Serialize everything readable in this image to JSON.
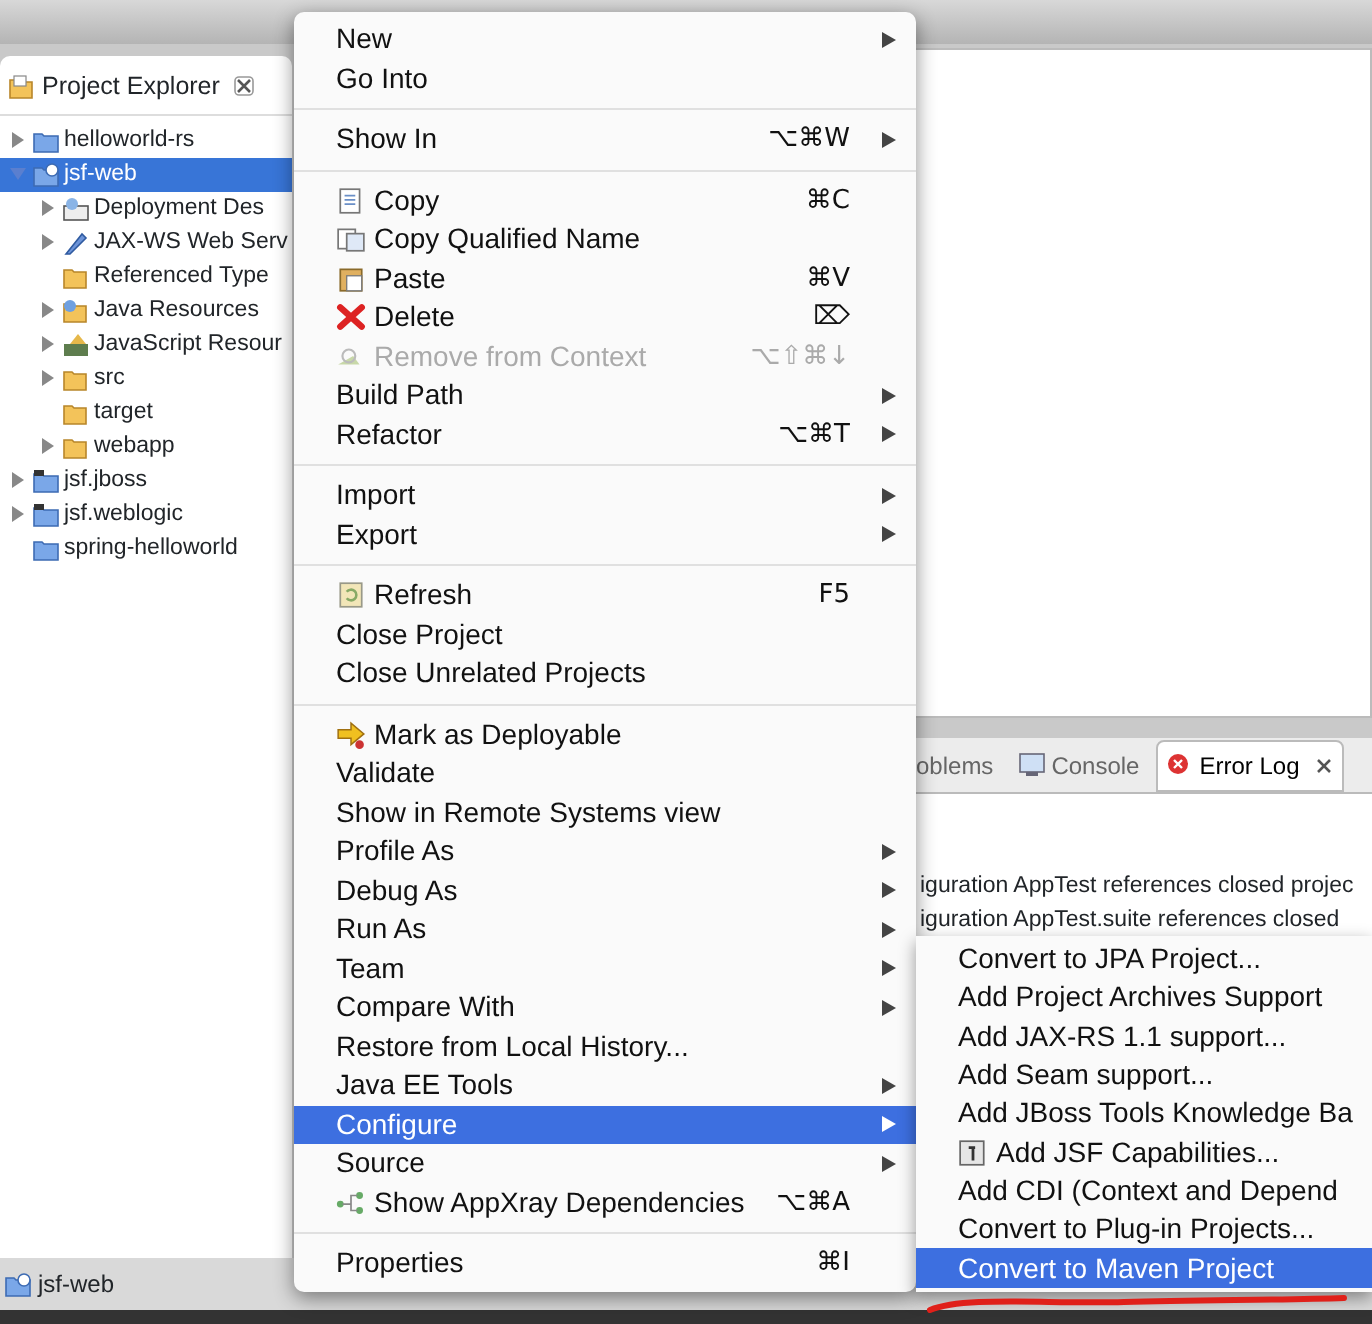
{
  "explorer": {
    "title": "Project Explorer",
    "tree": [
      {
        "label": "helloworld-rs",
        "kind": "project",
        "expanded": false,
        "selected": false
      },
      {
        "label": "jsf-web",
        "kind": "web-project",
        "expanded": true,
        "selected": true,
        "children": [
          {
            "label": "Deployment Des",
            "kind": "descriptor",
            "expanded": false,
            "selected": false
          },
          {
            "label": "JAX-WS Web Serv",
            "kind": "webservice",
            "expanded": false,
            "selected": false
          },
          {
            "label": "Referenced Type",
            "kind": "folder",
            "selected": false
          },
          {
            "label": "Java Resources",
            "kind": "java-resources",
            "expanded": false,
            "selected": false
          },
          {
            "label": "JavaScript Resour",
            "kind": "js-resources",
            "expanded": false,
            "selected": false
          },
          {
            "label": "src",
            "kind": "folder",
            "expanded": false,
            "selected": false
          },
          {
            "label": "target",
            "kind": "folder",
            "selected": false
          },
          {
            "label": "webapp",
            "kind": "folder",
            "expanded": false,
            "selected": false
          }
        ]
      },
      {
        "label": "jsf.jboss",
        "kind": "maven-project",
        "expanded": false,
        "selected": false
      },
      {
        "label": "jsf.weblogic",
        "kind": "maven-project",
        "expanded": false,
        "selected": false
      },
      {
        "label": "spring-helloworld",
        "kind": "project",
        "selected": false
      }
    ]
  },
  "bottom_panel": {
    "tabs": [
      {
        "label": "oblems",
        "kind": "plain",
        "selected": false
      },
      {
        "label": "Console",
        "kind": "console",
        "selected": false
      },
      {
        "label": "Error Log",
        "kind": "error-log",
        "selected": true
      }
    ],
    "log_lines": [
      "iguration AppTest references closed projec",
      "iguration AppTest.suite references closed"
    ]
  },
  "status_bar": {
    "label": "jsf-web"
  },
  "context_menu": {
    "groups": [
      [
        {
          "label": "New",
          "kind": "plain",
          "submenu": true,
          "disabled": false,
          "selected": false
        },
        {
          "label": "Go Into",
          "kind": "plain",
          "submenu": false,
          "disabled": false,
          "selected": false
        }
      ],
      [
        {
          "label": "Show In",
          "kind": "plain",
          "shortcut": "⌥⌘W",
          "submenu": true,
          "disabled": false,
          "selected": false
        }
      ],
      [
        {
          "label": "Copy",
          "kind": "copy",
          "shortcut": "⌘C",
          "submenu": false,
          "disabled": false,
          "selected": false
        },
        {
          "label": "Copy Qualified Name",
          "kind": "copy-name",
          "submenu": false,
          "disabled": false,
          "selected": false
        },
        {
          "label": "Paste",
          "kind": "paste",
          "shortcut": "⌘V",
          "submenu": false,
          "disabled": false,
          "selected": false
        },
        {
          "label": "Delete",
          "kind": "delete",
          "shortcut": "⌦",
          "submenu": false,
          "disabled": false,
          "selected": false
        },
        {
          "label": "Remove from Context",
          "kind": "remove",
          "shortcut": "⌥⇧⌘↓",
          "submenu": false,
          "disabled": true,
          "selected": false
        },
        {
          "label": "Build Path",
          "kind": "plain",
          "submenu": true,
          "disabled": false,
          "selected": false
        },
        {
          "label": "Refactor",
          "kind": "plain",
          "shortcut": "⌥⌘T",
          "submenu": true,
          "disabled": false,
          "selected": false
        }
      ],
      [
        {
          "label": "Import",
          "kind": "plain",
          "submenu": true,
          "disabled": false,
          "selected": false
        },
        {
          "label": "Export",
          "kind": "plain",
          "submenu": true,
          "disabled": false,
          "selected": false
        }
      ],
      [
        {
          "label": "Refresh",
          "kind": "refresh",
          "shortcut": "F5",
          "submenu": false,
          "disabled": false,
          "selected": false
        },
        {
          "label": "Close Project",
          "kind": "plain",
          "submenu": false,
          "disabled": false,
          "selected": false
        },
        {
          "label": "Close Unrelated Projects",
          "kind": "plain",
          "submenu": false,
          "disabled": false,
          "selected": false
        }
      ],
      [
        {
          "label": "Mark as Deployable",
          "kind": "deploy",
          "submenu": false,
          "disabled": false,
          "selected": false
        },
        {
          "label": "Validate",
          "kind": "plain",
          "submenu": false,
          "disabled": false,
          "selected": false
        },
        {
          "label": "Show in Remote Systems view",
          "kind": "plain",
          "submenu": false,
          "disabled": false,
          "selected": false
        },
        {
          "label": "Profile As",
          "kind": "plain",
          "submenu": true,
          "disabled": false,
          "selected": false
        },
        {
          "label": "Debug As",
          "kind": "plain",
          "submenu": true,
          "disabled": false,
          "selected": false
        },
        {
          "label": "Run As",
          "kind": "plain",
          "submenu": true,
          "disabled": false,
          "selected": false
        },
        {
          "label": "Team",
          "kind": "plain",
          "submenu": true,
          "disabled": false,
          "selected": false
        },
        {
          "label": "Compare With",
          "kind": "plain",
          "submenu": true,
          "disabled": false,
          "selected": false
        },
        {
          "label": "Restore from Local History...",
          "kind": "plain",
          "submenu": false,
          "disabled": false,
          "selected": false
        },
        {
          "label": "Java EE Tools",
          "kind": "plain",
          "submenu": true,
          "disabled": false,
          "selected": false
        },
        {
          "label": "Configure",
          "kind": "plain",
          "submenu": true,
          "disabled": false,
          "selected": true
        },
        {
          "label": "Source",
          "kind": "plain",
          "submenu": true,
          "disabled": false,
          "selected": false
        },
        {
          "label": "Show AppXray Dependencies",
          "kind": "graph",
          "shortcut": "⌥⌘A",
          "submenu": false,
          "disabled": false,
          "selected": false
        }
      ],
      [
        {
          "label": "Properties",
          "kind": "plain",
          "shortcut": "⌘I",
          "submenu": false,
          "disabled": false,
          "selected": false
        }
      ]
    ]
  },
  "configure_submenu": {
    "items": [
      {
        "label": "Convert to JPA Project...",
        "kind": "plain",
        "selected": false
      },
      {
        "label": "Add Project Archives Support",
        "kind": "plain",
        "selected": false
      },
      {
        "label": "Add JAX-RS 1.1 support...",
        "kind": "plain",
        "selected": false
      },
      {
        "label": "Add Seam support...",
        "kind": "plain",
        "selected": false
      },
      {
        "label": "Add JBoss Tools Knowledge Ba",
        "kind": "plain",
        "selected": false
      },
      {
        "label": "Add JSF Capabilities...",
        "kind": "jsf",
        "selected": false
      },
      {
        "label": "Add CDI (Context and Depend",
        "kind": "plain",
        "selected": false
      },
      {
        "label": "Convert to Plug-in Projects...",
        "kind": "plain",
        "selected": false
      },
      {
        "label": "Convert to Maven Project",
        "kind": "plain",
        "selected": true
      }
    ]
  }
}
